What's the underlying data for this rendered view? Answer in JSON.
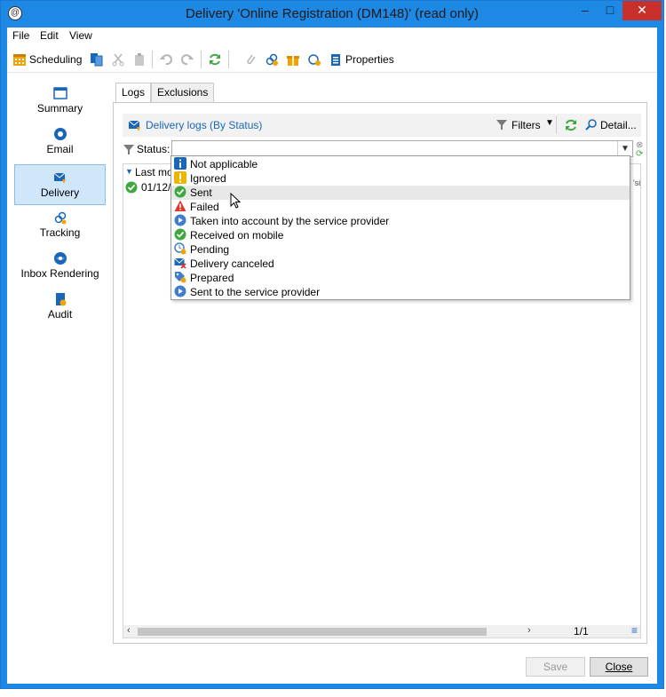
{
  "window": {
    "title": "Delivery 'Online Registration (DM148)' (read only)",
    "minimize_glyph": "–",
    "maximize_glyph": "□",
    "close_glyph": "✕"
  },
  "menu": [
    "File",
    "Edit",
    "View"
  ],
  "toolbar": {
    "scheduling_label": "Scheduling",
    "properties_label": "Properties"
  },
  "sidebar": {
    "items": [
      {
        "label": "Summary",
        "icon": "summary-icon"
      },
      {
        "label": "Email",
        "icon": "email-icon"
      },
      {
        "label": "Delivery",
        "icon": "delivery-icon",
        "active": true
      },
      {
        "label": "Tracking",
        "icon": "tracking-icon"
      },
      {
        "label": "Inbox Rendering",
        "icon": "inbox-rendering-icon"
      },
      {
        "label": "Audit",
        "icon": "audit-icon"
      }
    ]
  },
  "tabs": {
    "logs": "Logs",
    "exclusions": "Exclusions"
  },
  "logs_header": {
    "title": "Delivery logs (By Status)",
    "filters_label": "Filters",
    "detail_label": "Detail..."
  },
  "filter": {
    "status_label": "Status:",
    "status_value": ""
  },
  "grid": {
    "column_partial": "Last mo",
    "row_partial": "01/12/2",
    "right_clip": "'si",
    "pager": "1/1"
  },
  "dropdown": {
    "options": [
      {
        "label": "Not applicable",
        "icon": "info-icon"
      },
      {
        "label": "Ignored",
        "icon": "warning-yellow-icon"
      },
      {
        "label": "Sent",
        "icon": "check-green-icon",
        "hover": true
      },
      {
        "label": "Failed",
        "icon": "alert-red-icon"
      },
      {
        "label": "Taken into account by the service provider",
        "icon": "play-blue-icon"
      },
      {
        "label": "Received on mobile",
        "icon": "check-green-icon"
      },
      {
        "label": "Pending",
        "icon": "pending-clock-icon"
      },
      {
        "label": "Delivery canceled",
        "icon": "canceled-envelope-icon"
      },
      {
        "label": "Prepared",
        "icon": "prepared-tag-icon"
      },
      {
        "label": "Sent to the service provider",
        "icon": "play-blue-icon"
      }
    ]
  },
  "footer": {
    "save_label": "Save",
    "close_label": "Close"
  },
  "colors": {
    "titlebar": "#1e88e5",
    "close_button": "#c9302c",
    "active_sidebar": "#cfe6fb",
    "accent_blue": "#1a67b8",
    "green": "#3ea83e",
    "red": "#d93a2b",
    "yellow": "#f0b400"
  }
}
